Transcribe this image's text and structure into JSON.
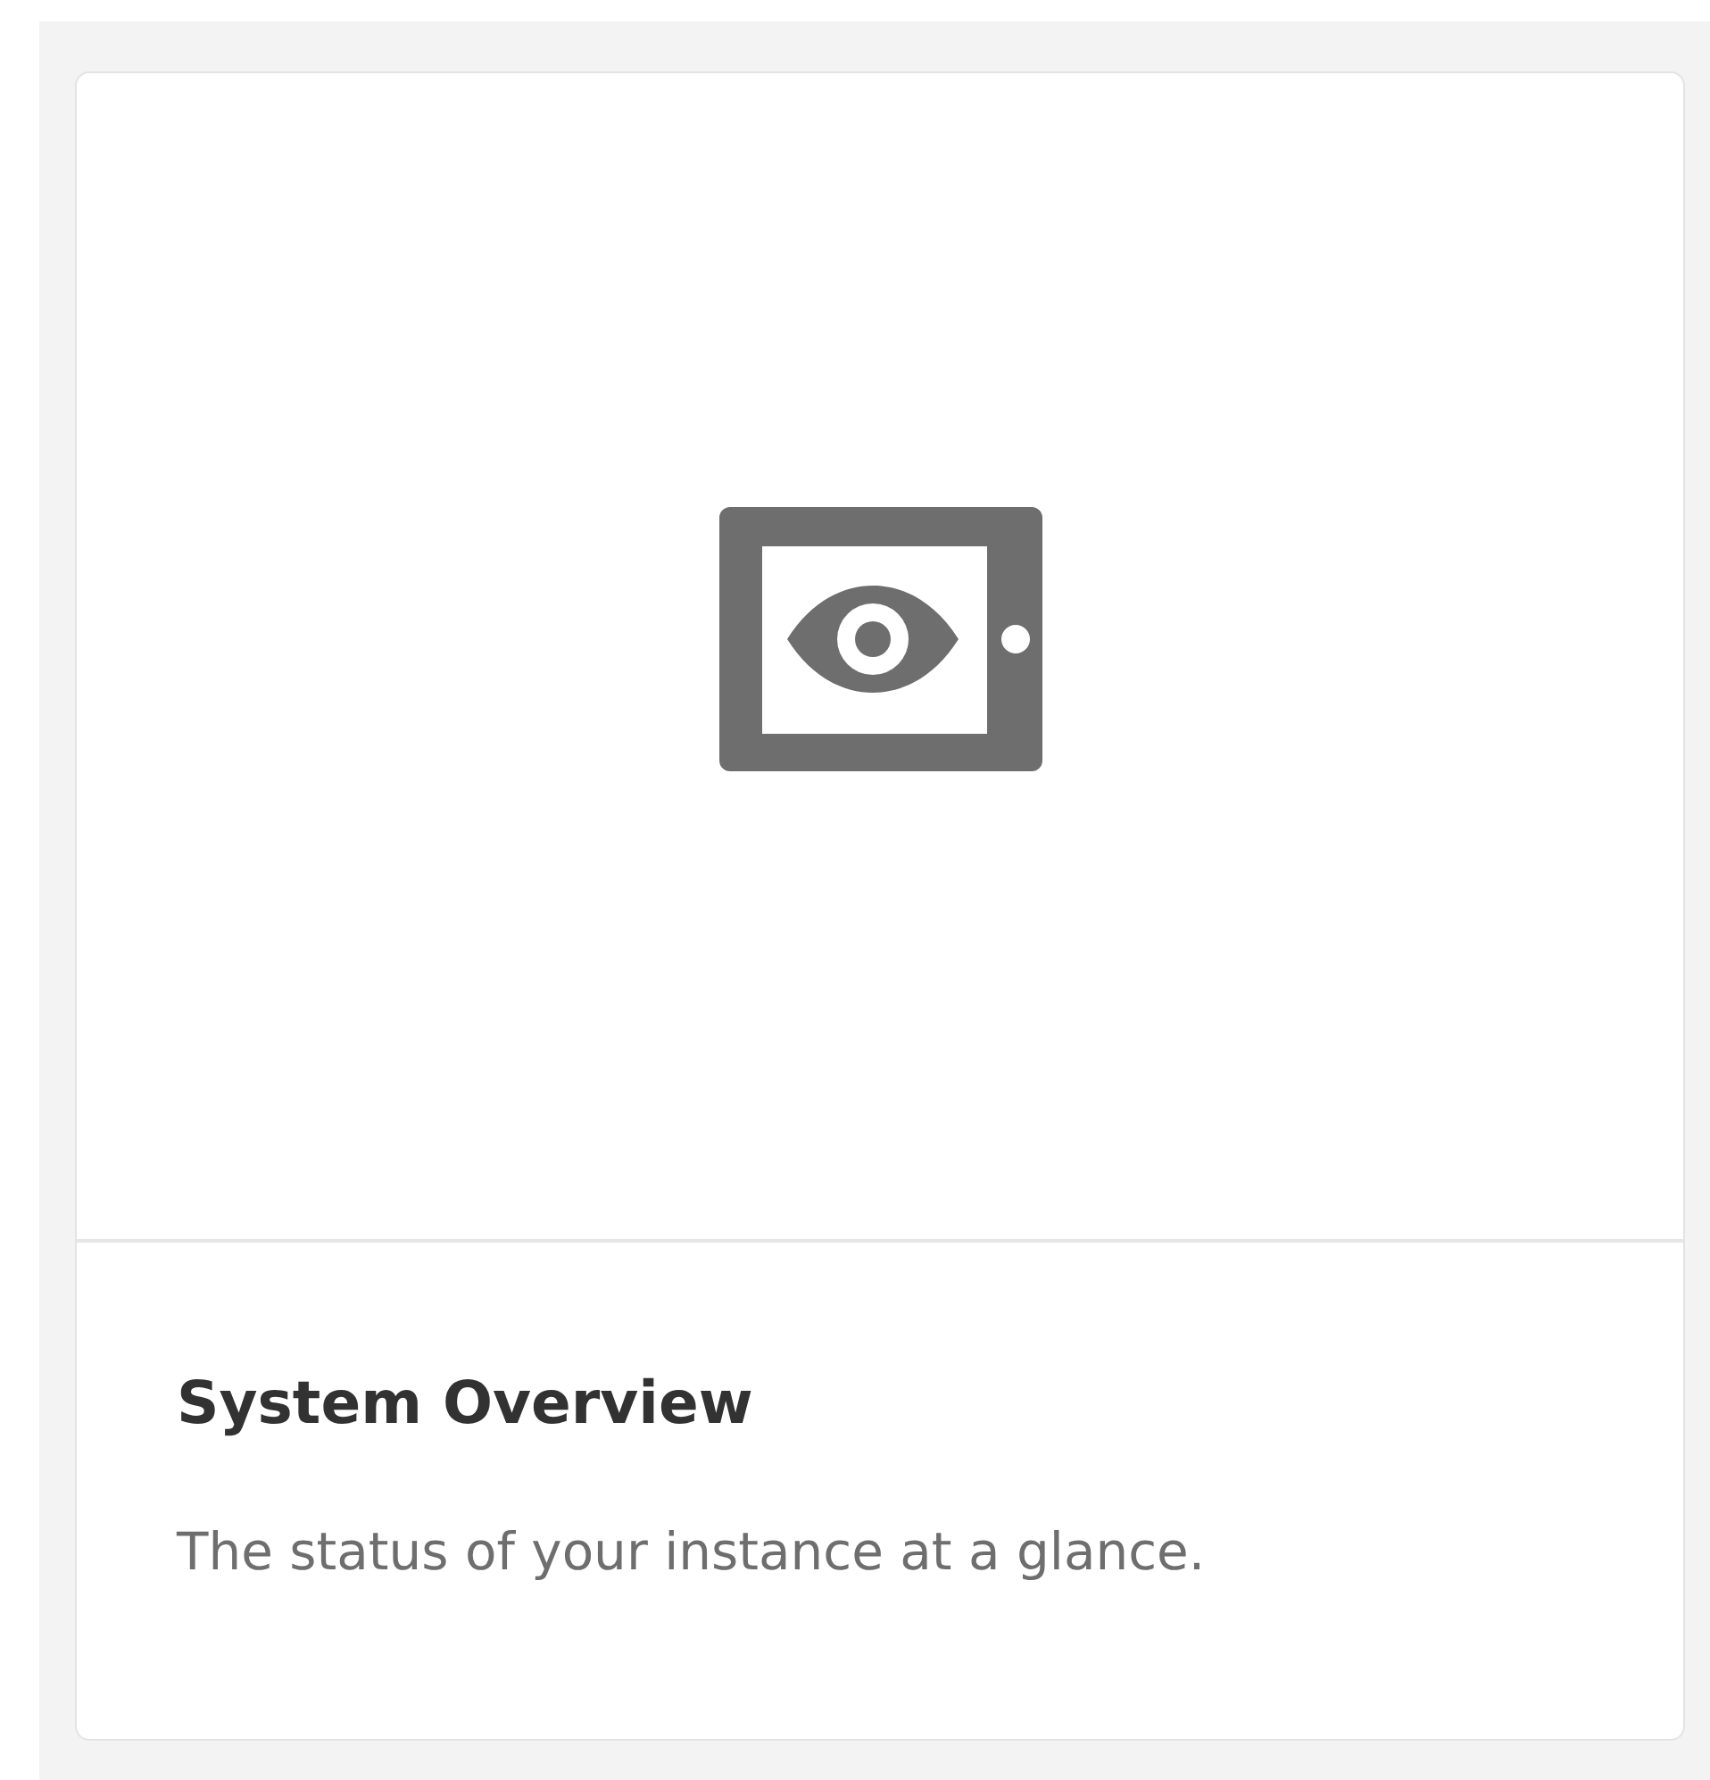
{
  "card": {
    "title": "System Overview",
    "description": "The status of your instance at a glance."
  }
}
